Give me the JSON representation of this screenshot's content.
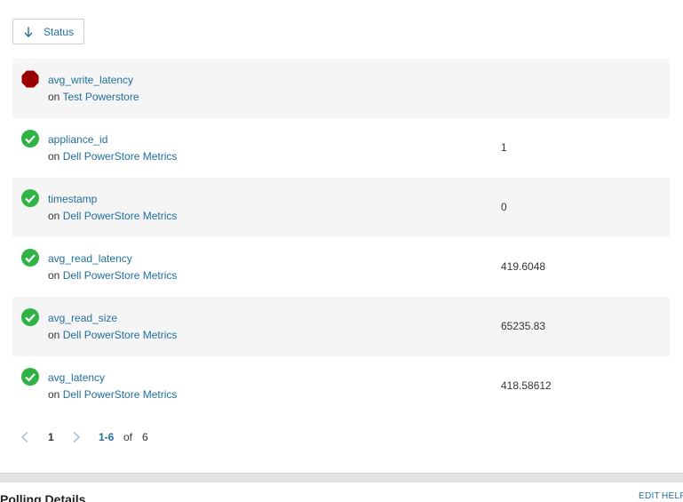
{
  "sort": {
    "label": "Status",
    "icon": "arrow-down-icon",
    "accent": "#1f6f9c"
  },
  "rows": [
    {
      "name": "avg_write_latency",
      "on": "on",
      "source": "Test Powerstore",
      "value": "",
      "status": "error",
      "status_icon": "stop-octagon-icon",
      "status_color": "#9b0000"
    },
    {
      "name": "appliance_id",
      "on": "on",
      "source": "Dell PowerStore Metrics",
      "value": "1",
      "status": "ok",
      "status_icon": "check-circle-icon",
      "status_color": "#2fb344"
    },
    {
      "name": "timestamp",
      "on": "on",
      "source": "Dell PowerStore Metrics",
      "value": "0",
      "status": "ok",
      "status_icon": "check-circle-icon",
      "status_color": "#2fb344"
    },
    {
      "name": "avg_read_latency",
      "on": "on",
      "source": "Dell PowerStore Metrics",
      "value": "419.6048",
      "status": "ok",
      "status_icon": "check-circle-icon",
      "status_color": "#2fb344"
    },
    {
      "name": "avg_read_size",
      "on": "on",
      "source": "Dell PowerStore Metrics",
      "value": "65235.83",
      "status": "ok",
      "status_icon": "check-circle-icon",
      "status_color": "#2fb344"
    },
    {
      "name": "avg_latency",
      "on": "on",
      "source": "Dell PowerStore Metrics",
      "value": "418.58612",
      "status": "ok",
      "status_icon": "check-circle-icon",
      "status_color": "#2fb344"
    }
  ],
  "pagination": {
    "page": "1",
    "range": "1-6",
    "of_label": "of",
    "total": "6"
  },
  "section": {
    "title": "Polling Details",
    "edit_label": "EDIT",
    "help_label": "HELP"
  }
}
